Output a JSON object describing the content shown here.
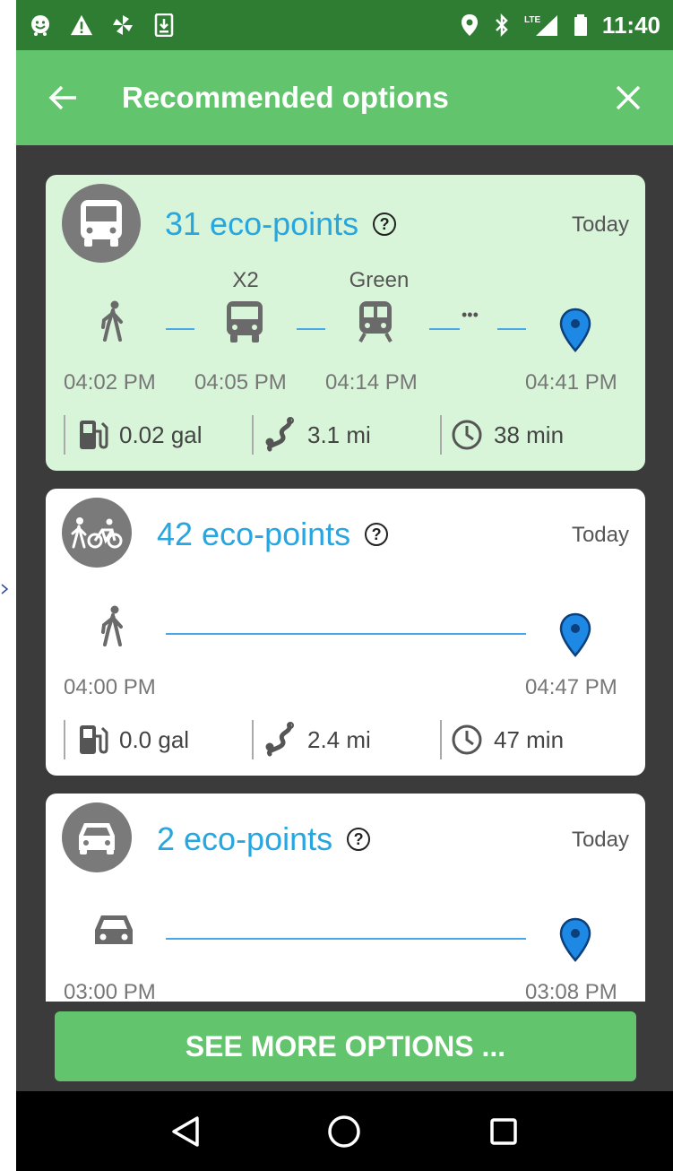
{
  "status_bar": {
    "time": "11:40",
    "left_icons": [
      "waze-icon",
      "warning-icon",
      "pinwheel-icon",
      "download-icon"
    ],
    "right_icons": [
      "location-icon",
      "bluetooth-icon",
      "lte-signal-icon",
      "battery-icon"
    ]
  },
  "app_bar": {
    "title": "Recommended options",
    "back_icon": "arrow-left-icon",
    "close_icon": "close-icon"
  },
  "options": [
    {
      "mode": "bus-icon",
      "eco_points": "31 eco-points",
      "help": "?",
      "day": "Today",
      "selected": true,
      "legs": [
        {
          "icon": "walk-icon",
          "label": "",
          "time": "04:02 PM"
        },
        {
          "icon": "bus-icon",
          "label": "X2",
          "time": "04:05 PM"
        },
        {
          "icon": "train-icon",
          "label": "Green",
          "time": "04:14 PM"
        },
        {
          "icon": "destination-pin-icon",
          "label": "",
          "time": "04:41 PM"
        }
      ],
      "more_dots": "•••",
      "fuel": "0.02 gal",
      "distance": "3.1 mi",
      "duration": "38 min"
    },
    {
      "mode": "walk-bike-icon",
      "eco_points": "42 eco-points",
      "help": "?",
      "day": "Today",
      "selected": false,
      "start_time": "04:00 PM",
      "end_time": "04:47 PM",
      "fuel": "0.0 gal",
      "distance": "2.4 mi",
      "duration": "47 min"
    },
    {
      "mode": "car-icon",
      "eco_points": "2 eco-points",
      "help": "?",
      "day": "Today",
      "selected": false,
      "start_time": "03:00 PM",
      "end_time": "03:08 PM"
    }
  ],
  "see_more_label": "SEE MORE OPTIONS ...",
  "nav_bar": [
    "back-triangle-icon",
    "home-circle-icon",
    "recents-square-icon"
  ],
  "colors": {
    "status_bar": "#2e7d32",
    "app_bar": "#62c46c",
    "selected_card": "#d9f5d9",
    "points_text": "#27a6e0",
    "pin": "#1e88e5",
    "background": "#3b3b3b"
  }
}
